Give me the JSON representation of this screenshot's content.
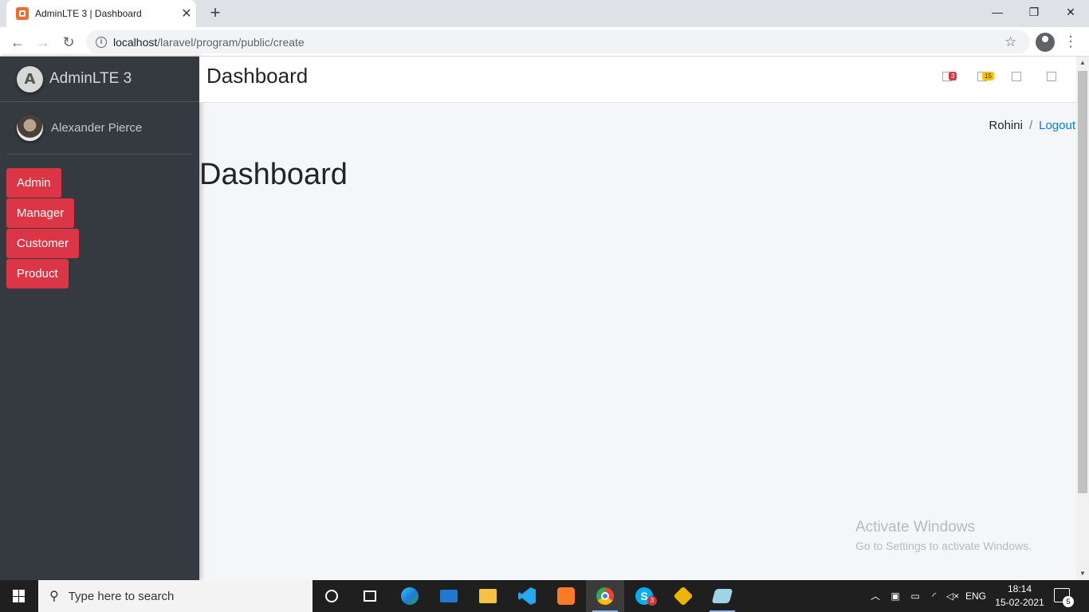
{
  "browser": {
    "tab_title": "AdminLTE 3 | Dashboard",
    "tab_close": "✕",
    "new_tab": "+",
    "url_host": "localhost",
    "url_path": "/laravel/program/public/create",
    "controls": {
      "minimize": "—",
      "restore": "❐",
      "close": "✕"
    }
  },
  "sidebar": {
    "brand": "AdminLTE 3",
    "user_name": "Alexander Pierce",
    "menu": [
      {
        "label": "Admin"
      },
      {
        "label": "Manager"
      },
      {
        "label": "Customer"
      },
      {
        "label": "Product"
      }
    ],
    "button_color": "#dc3545"
  },
  "header": {
    "title": "Dashboard",
    "badges": {
      "messages": "3",
      "notifications": "15"
    }
  },
  "breadcrumb": {
    "user": "Rohini",
    "separator": "/",
    "logout": "Logout"
  },
  "main": {
    "heading": "Dashboard"
  },
  "watermark": {
    "line1": "Activate Windows",
    "line2": "Go to Settings to activate Windows."
  },
  "taskbar": {
    "search_placeholder": "Type here to search",
    "skype_badge": "3",
    "language": "ENG",
    "time": "18:14",
    "date": "15-02-2021",
    "notification_count": "5"
  }
}
